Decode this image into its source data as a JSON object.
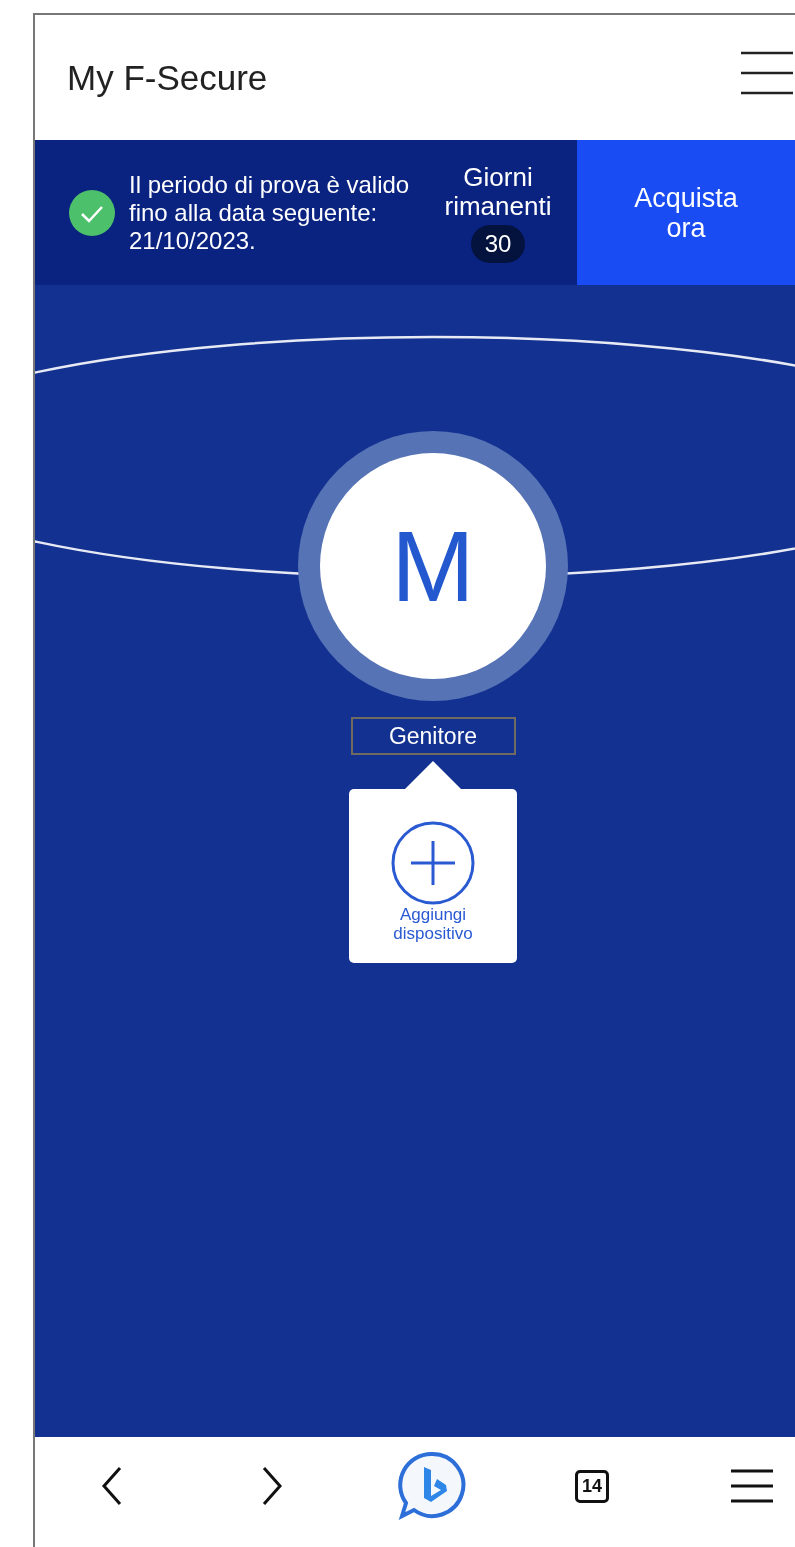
{
  "header": {
    "title": "My F-Secure"
  },
  "trial_banner": {
    "message": "Il periodo di prova è valido fino alla data seguente: 21/10/2023.",
    "days_label": "Giorni rimanenti",
    "days_count": "30",
    "buy_button": "Acquista ora"
  },
  "profile": {
    "initial": "M",
    "label": "Genitore",
    "add_device": "Aggiungi dispositivo"
  },
  "browser_bar": {
    "tab_count": "14"
  }
}
